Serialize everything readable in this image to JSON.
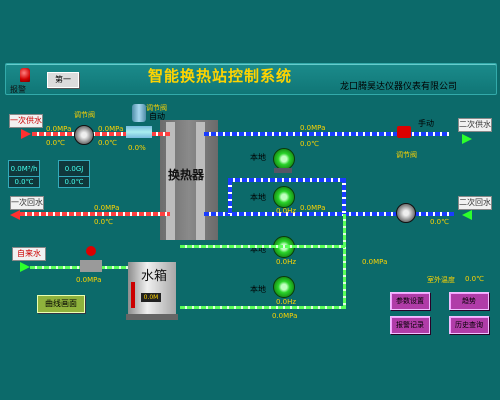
{
  "header": {
    "title": "智能换热站控制系统",
    "company": "龙口腾昊达仪器仪表有限公司",
    "alarm_label": "报警",
    "mini_button": "第一"
  },
  "signs": {
    "primary_supply": "一次供水",
    "primary_return": "一次回水",
    "makeup_water": "自来水",
    "secondary_supply": "二次供水",
    "secondary_return": "二次回水"
  },
  "labels": {
    "exchanger": "换热器",
    "water_tank": "水箱",
    "auto": "自动",
    "manual": "手动",
    "local": "本地",
    "control_valve": "调节阀"
  },
  "readings": {
    "supply_pressure_a": "0.0MPa",
    "supply_pressure_b": "0.0MPa",
    "supply_temp": "0.0℃",
    "valve_open": "0.0%",
    "sec_pressure": "0.0MPa",
    "sec_temp": "0.0℃",
    "flow_rate": "0.0M³/h",
    "heat_value": "0.0GJ",
    "ret_pressure": "0.0MPa",
    "ret_temp": "0.0℃",
    "makeup_pressure": "0.0MPa",
    "pump_freq": "0.0Hz",
    "outdoor_temp_label": "室外温度",
    "outdoor_temp": "0.0℃",
    "tank_level": "0.0M"
  },
  "buttons": {
    "open_cut": "曲线画面",
    "param_set": "参数设置",
    "trend": "趋势",
    "alarm_record": "报警记录",
    "history": "历史查询"
  },
  "colors": {
    "background": "#0c6a6a",
    "title": "#ffd400",
    "supply_pipe": "#ff4040",
    "secondary_pipe": "#1a3cff",
    "makeup_pipe": "#5aff5a"
  }
}
